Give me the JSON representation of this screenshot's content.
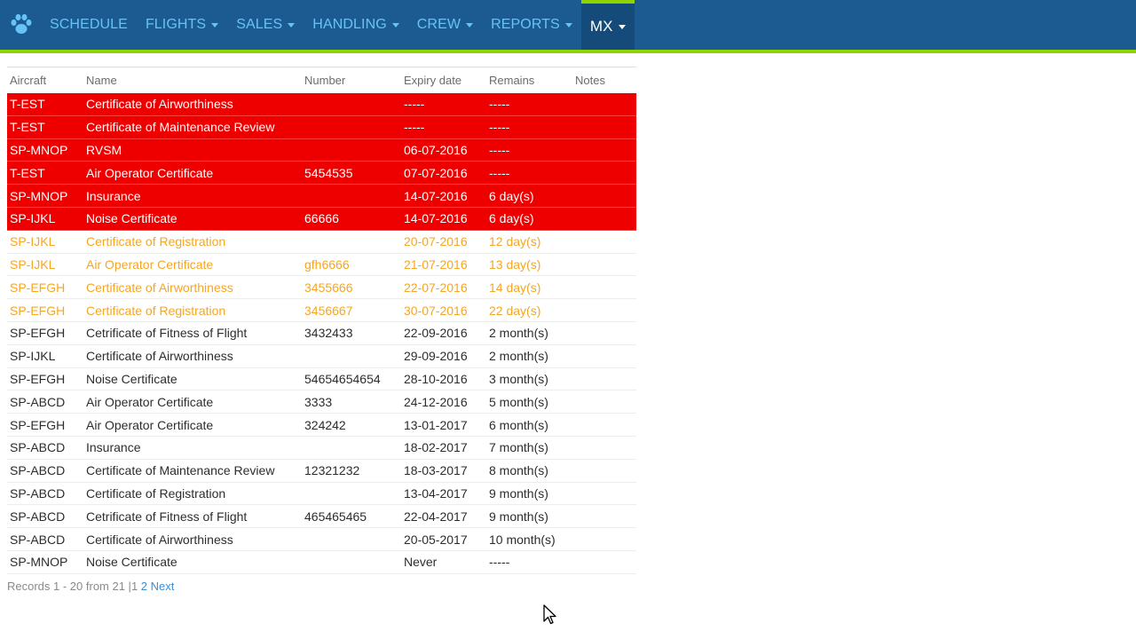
{
  "nav": {
    "items": [
      {
        "label": "SCHEDULE",
        "dropdown": false,
        "active": false
      },
      {
        "label": "FLIGHTS",
        "dropdown": true,
        "active": false
      },
      {
        "label": "SALES",
        "dropdown": true,
        "active": false
      },
      {
        "label": "HANDLING",
        "dropdown": true,
        "active": false
      },
      {
        "label": "CREW",
        "dropdown": true,
        "active": false
      },
      {
        "label": "REPORTS",
        "dropdown": true,
        "active": false
      },
      {
        "label": "MX",
        "dropdown": true,
        "active": true
      }
    ],
    "logo_icon": "paw-icon"
  },
  "colors": {
    "nav_bg": "#1b5b92",
    "nav_text": "#67c3f5",
    "accent": "#8fd400",
    "expired_row": "#ee0000",
    "warning_text": "#f5a623"
  },
  "table": {
    "headers": {
      "aircraft": "Aircraft",
      "name": "Name",
      "number": "Number",
      "expiry": "Expiry date",
      "remains": "Remains",
      "notes": "Notes"
    },
    "rows": [
      {
        "aircraft": "T-EST",
        "name": "Certificate of Airworthiness",
        "number": "",
        "expiry": "-----",
        "remains": "-----",
        "notes": "",
        "status": "expired"
      },
      {
        "aircraft": "T-EST",
        "name": "Certificate of Maintenance Review",
        "number": "",
        "expiry": "-----",
        "remains": "-----",
        "notes": "",
        "status": "expired"
      },
      {
        "aircraft": "SP-MNOP",
        "name": "RVSM",
        "number": "",
        "expiry": "06-07-2016",
        "remains": "-----",
        "notes": "",
        "status": "expired"
      },
      {
        "aircraft": "T-EST",
        "name": "Air Operator Certificate",
        "number": "5454535",
        "expiry": "07-07-2016",
        "remains": "-----",
        "notes": "",
        "status": "expired"
      },
      {
        "aircraft": "SP-MNOP",
        "name": "Insurance",
        "number": "",
        "expiry": "14-07-2016",
        "remains": "6 day(s)",
        "notes": "",
        "status": "expired"
      },
      {
        "aircraft": "SP-IJKL",
        "name": "Noise Certificate",
        "number": "66666",
        "expiry": "14-07-2016",
        "remains": "6 day(s)",
        "notes": "",
        "status": "expired"
      },
      {
        "aircraft": "SP-IJKL",
        "name": "Certificate of Registration",
        "number": "",
        "expiry": "20-07-2016",
        "remains": "12 day(s)",
        "notes": "",
        "status": "warning"
      },
      {
        "aircraft": "SP-IJKL",
        "name": "Air Operator Certificate",
        "number": "gfh6666",
        "expiry": "21-07-2016",
        "remains": "13 day(s)",
        "notes": "",
        "status": "warning"
      },
      {
        "aircraft": "SP-EFGH",
        "name": "Certificate of Airworthiness",
        "number": "3455666",
        "expiry": "22-07-2016",
        "remains": "14 day(s)",
        "notes": "",
        "status": "warning"
      },
      {
        "aircraft": "SP-EFGH",
        "name": "Certificate of Registration",
        "number": "3456667",
        "expiry": "30-07-2016",
        "remains": "22 day(s)",
        "notes": "",
        "status": "warning"
      },
      {
        "aircraft": "SP-EFGH",
        "name": "Cetrificate of Fitness of Flight",
        "number": "3432433",
        "expiry": "22-09-2016",
        "remains": "2 month(s)",
        "notes": "",
        "status": "ok"
      },
      {
        "aircraft": "SP-IJKL",
        "name": "Certificate of Airworthiness",
        "number": "",
        "expiry": "29-09-2016",
        "remains": "2 month(s)",
        "notes": "",
        "status": "ok"
      },
      {
        "aircraft": "SP-EFGH",
        "name": "Noise Certificate",
        "number": "54654654654",
        "expiry": "28-10-2016",
        "remains": "3 month(s)",
        "notes": "",
        "status": "ok"
      },
      {
        "aircraft": "SP-ABCD",
        "name": "Air Operator Certificate",
        "number": "3333",
        "expiry": "24-12-2016",
        "remains": "5 month(s)",
        "notes": "",
        "status": "ok"
      },
      {
        "aircraft": "SP-EFGH",
        "name": "Air Operator Certificate",
        "number": "324242",
        "expiry": "13-01-2017",
        "remains": "6 month(s)",
        "notes": "",
        "status": "ok"
      },
      {
        "aircraft": "SP-ABCD",
        "name": "Insurance",
        "number": "",
        "expiry": "18-02-2017",
        "remains": "7 month(s)",
        "notes": "",
        "status": "ok"
      },
      {
        "aircraft": "SP-ABCD",
        "name": "Certificate of Maintenance Review",
        "number": "12321232",
        "expiry": "18-03-2017",
        "remains": "8 month(s)",
        "notes": "",
        "status": "ok"
      },
      {
        "aircraft": "SP-ABCD",
        "name": "Certificate of Registration",
        "number": "",
        "expiry": "13-04-2017",
        "remains": "9 month(s)",
        "notes": "",
        "status": "ok"
      },
      {
        "aircraft": "SP-ABCD",
        "name": "Cetrificate of Fitness of Flight",
        "number": "465465465",
        "expiry": "22-04-2017",
        "remains": "9 month(s)",
        "notes": "",
        "status": "ok"
      },
      {
        "aircraft": "SP-ABCD",
        "name": "Certificate of Airworthiness",
        "number": "",
        "expiry": "20-05-2017",
        "remains": "10 month(s)",
        "notes": "",
        "status": "ok"
      },
      {
        "aircraft": "SP-MNOP",
        "name": "Noise Certificate",
        "number": "",
        "expiry": "Never",
        "remains": "-----",
        "notes": "",
        "status": "ok"
      }
    ]
  },
  "pager": {
    "summary": "Records 1 - 20 from 21 |",
    "current_page": "1",
    "page_2": "2",
    "next": "Next"
  }
}
